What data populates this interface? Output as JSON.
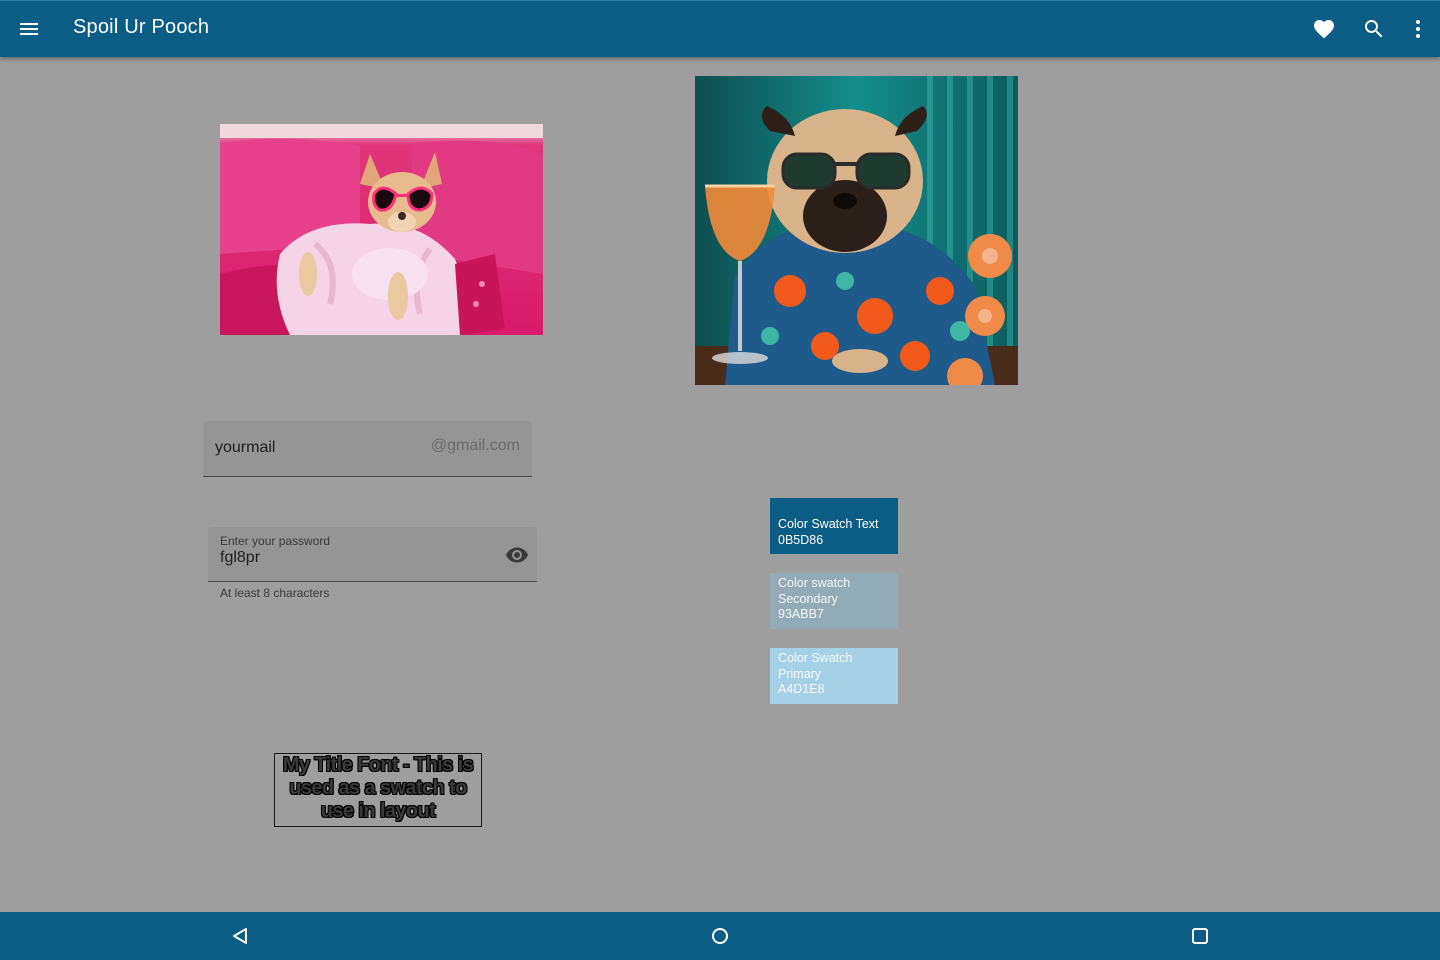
{
  "app_bar": {
    "title": "Spoil Ur Pooch",
    "menu_icon": "menu-icon",
    "actions": [
      "heart-icon",
      "search-icon",
      "more-vert-icon"
    ]
  },
  "images": {
    "chihuahua": "chihuahua-in-pink-robe-with-heart-sunglasses",
    "pug": "pug-in-hawaiian-shirt-with-sunglasses-and-cocktail"
  },
  "email_field": {
    "value": "yourmail",
    "suffix": "@gmail.com"
  },
  "password_field": {
    "label": "Enter your password",
    "value": "fgl8pr",
    "helper": "At least 8 characters",
    "toggle_icon": "eye-icon"
  },
  "title_swatch": {
    "text": "My Title Font - This is used as a swatch to use in layout"
  },
  "swatches": {
    "text": {
      "line1": "Color Swatch Text",
      "line2": "0B5D86",
      "color": "#0B5D86"
    },
    "secondary": {
      "line1": "Color swatch",
      "line2": "Secondary",
      "line3": "93ABB7",
      "color": "#93ABB7"
    },
    "primary": {
      "line1": "Color Swatch",
      "line2": "Primary",
      "line3": "A4D1E8",
      "color": "#A4D1E8"
    }
  },
  "nav_bar": {
    "icons": [
      "back-icon",
      "home-icon",
      "recents-icon"
    ]
  },
  "colors": {
    "bar": "#0B5D86",
    "background": "#9E9E9E"
  }
}
